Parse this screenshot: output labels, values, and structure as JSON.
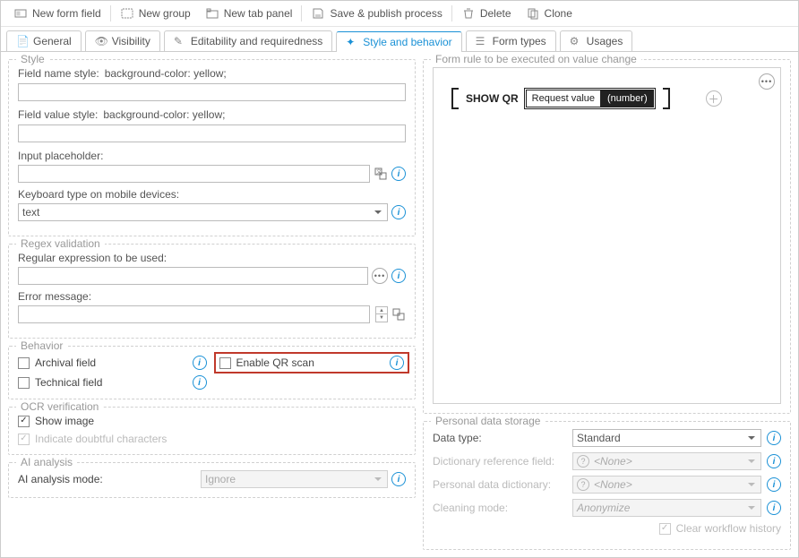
{
  "toolbar": {
    "new_field": "New form field",
    "new_group": "New group",
    "new_tab_panel": "New tab panel",
    "save_publish": "Save & publish process",
    "delete": "Delete",
    "clone": "Clone"
  },
  "tabs": [
    {
      "label": "General"
    },
    {
      "label": "Visibility"
    },
    {
      "label": "Editability and requiredness"
    },
    {
      "label": "Style and behavior"
    },
    {
      "label": "Form types"
    },
    {
      "label": "Usages"
    }
  ],
  "active_tab_index": 3,
  "style": {
    "title": "Style",
    "field_name_style_label": "Field name style:",
    "field_name_style_value": "background-color: yellow;",
    "field_value_style_label": "Field value style:",
    "field_value_style_value": "background-color: yellow;",
    "input_placeholder_label": "Input placeholder:",
    "keyboard_label": "Keyboard type on mobile devices:",
    "keyboard_value": "text"
  },
  "regex": {
    "title": "Regex validation",
    "expr_label": "Regular expression to be used:",
    "error_label": "Error message:"
  },
  "behavior": {
    "title": "Behavior",
    "archival": "Archival field",
    "technical": "Technical field",
    "enable_qr": "Enable QR scan"
  },
  "ocr": {
    "title": "OCR verification",
    "show_image": "Show image",
    "doubtful": "Indicate doubtful characters"
  },
  "ai": {
    "title": "AI analysis",
    "mode_label": "AI analysis mode:",
    "mode_value": "Ignore"
  },
  "rule": {
    "title": "Form rule to be executed on value change",
    "show_qr": "SHOW QR",
    "request_value": "Request value",
    "number": "(number)"
  },
  "personal": {
    "title": "Personal data storage",
    "data_type_label": "Data type:",
    "data_type_value": "Standard",
    "dict_ref_label": "Dictionary reference field:",
    "dict_ref_value": "<None>",
    "dict_label": "Personal data dictionary:",
    "dict_value": "<None>",
    "cleaning_label": "Cleaning mode:",
    "cleaning_value": "Anonymize",
    "clear_history": "Clear workflow history"
  }
}
